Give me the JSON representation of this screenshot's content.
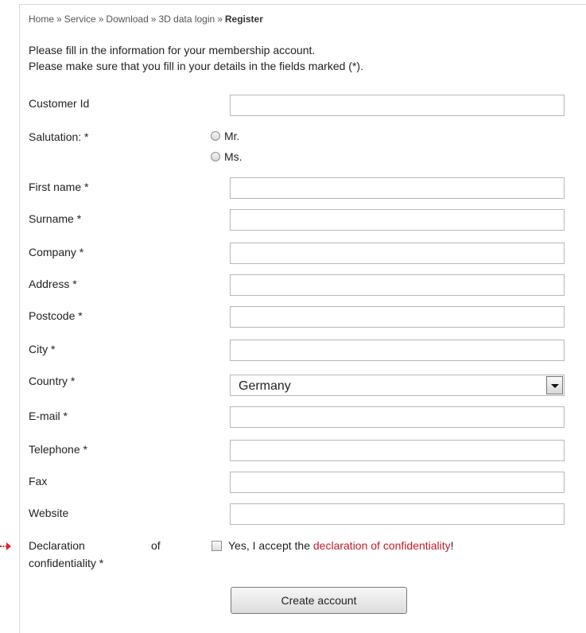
{
  "breadcrumb": {
    "items": [
      "Home",
      "Service",
      "Download",
      "3D data login"
    ],
    "separator": "»",
    "current": "Register"
  },
  "intro": {
    "line1": "Please fill in the information for your membership account.",
    "line2": "Please make sure that you fill in your details in the fields marked (*)."
  },
  "form": {
    "customer_id": {
      "label": "Customer Id",
      "value": ""
    },
    "salutation": {
      "label": "Salutation: *",
      "options": [
        "Mr.",
        "Ms."
      ],
      "selected": ""
    },
    "first_name": {
      "label": "First name *",
      "value": ""
    },
    "surname": {
      "label": "Surname *",
      "value": ""
    },
    "company": {
      "label": "Company *",
      "value": ""
    },
    "address": {
      "label": "Address *",
      "value": ""
    },
    "postcode": {
      "label": "Postcode *",
      "value": ""
    },
    "city": {
      "label": "City *",
      "value": ""
    },
    "country": {
      "label": "Country *",
      "selected": "Germany"
    },
    "email": {
      "label": "E-mail *",
      "value": ""
    },
    "telephone": {
      "label": "Telephone *",
      "value": ""
    },
    "fax": {
      "label": "Fax",
      "value": ""
    },
    "website": {
      "label": "Website",
      "value": ""
    },
    "declaration": {
      "label_word1": "Declaration",
      "label_word2": "of",
      "label_line2": "confidentiality *",
      "checkbox_text_before": "Yes, I accept the ",
      "link_text": "declaration of confidentiality",
      "checkbox_text_after": "!",
      "checked": false
    },
    "submit_label": "Create account"
  },
  "colors": {
    "link_red": "#c41a2b",
    "arrow_red": "#e2202a",
    "border": "#b7b7b7"
  }
}
